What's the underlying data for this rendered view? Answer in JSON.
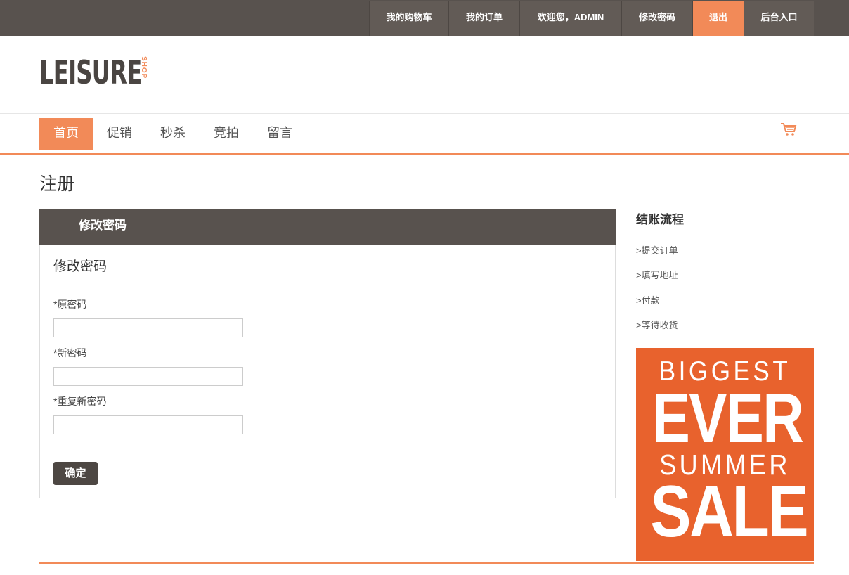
{
  "topnav": {
    "items": [
      {
        "label": "我的购物车"
      },
      {
        "label": "我的订单"
      },
      {
        "label": "欢迎您，ADMIN"
      },
      {
        "label": "修改密码"
      },
      {
        "label": "退出",
        "active": true
      },
      {
        "label": "后台入口"
      }
    ]
  },
  "logo": {
    "text": "LEISURE",
    "sub": "SHOP"
  },
  "mainnav": {
    "items": [
      {
        "label": "首页",
        "active": true
      },
      {
        "label": "促销"
      },
      {
        "label": "秒杀"
      },
      {
        "label": "竞拍"
      },
      {
        "label": "留言"
      }
    ],
    "cart_icon": "shopping-cart-icon"
  },
  "page": {
    "title": "注册"
  },
  "panel": {
    "header": "修改密码",
    "form_title": "修改密码",
    "fields": [
      {
        "label": "*原密码",
        "value": ""
      },
      {
        "label": "*新密码",
        "value": ""
      },
      {
        "label": "*重复新密码",
        "value": ""
      }
    ],
    "submit_label": "确定"
  },
  "sidebar": {
    "title": "结账流程",
    "items": [
      {
        "label": ">提交订单"
      },
      {
        "label": ">填写地址"
      },
      {
        "label": ">付款"
      },
      {
        "label": ">等待收货"
      }
    ],
    "banner": {
      "line1": "BIGGEST",
      "line2": "EVER",
      "line3": "SUMMER",
      "line4": "SALE"
    }
  },
  "colors": {
    "accent": "#f28a58",
    "dark": "#58524e",
    "banner": "#e8622d"
  }
}
